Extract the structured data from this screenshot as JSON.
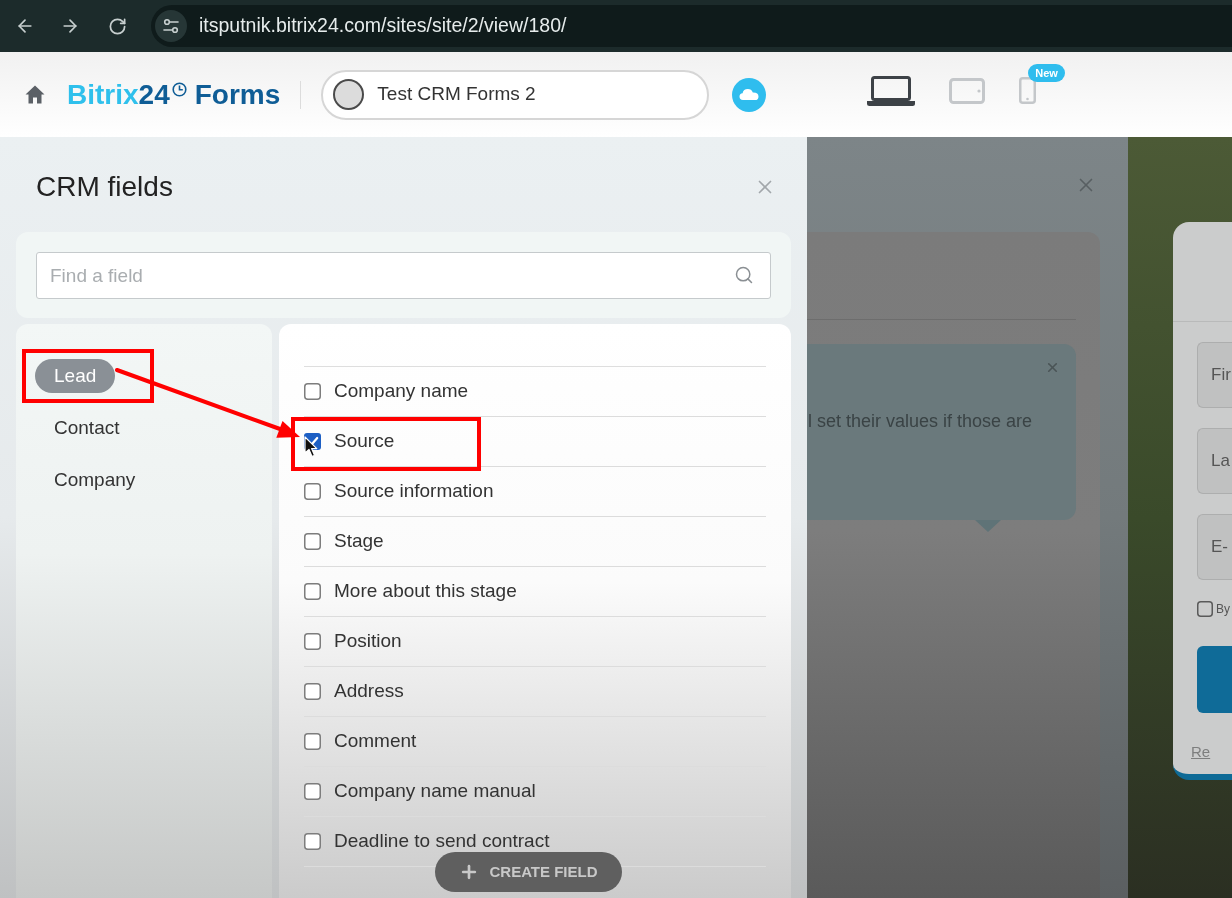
{
  "browser": {
    "url": "itsputnik.bitrix24.com/sites/site/2/view/180/"
  },
  "header": {
    "logo": {
      "brand": "Bitrix",
      "number": "24",
      "product": "Forms"
    },
    "site_selector": {
      "value": "Test CRM Forms 2"
    },
    "devices": [
      {
        "kind": "laptop",
        "selected": true
      },
      {
        "kind": "tablet",
        "selected": false
      },
      {
        "kind": "phone",
        "selected": false,
        "badge": "New"
      }
    ]
  },
  "crm_fields_panel": {
    "title": "CRM fields",
    "search": {
      "placeholder": "Find a field"
    },
    "entities": [
      {
        "label": "Lead",
        "selected": true
      },
      {
        "label": "Contact",
        "selected": false
      },
      {
        "label": "Company",
        "selected": false
      }
    ],
    "fields": [
      {
        "label": "Company name",
        "checked": false
      },
      {
        "label": "Source",
        "checked": true
      },
      {
        "label": "Source information",
        "checked": false
      },
      {
        "label": "Stage",
        "checked": false
      },
      {
        "label": "More about this stage",
        "checked": false
      },
      {
        "label": "Position",
        "checked": false
      },
      {
        "label": "Address",
        "checked": false
      },
      {
        "label": "Comment",
        "checked": false
      },
      {
        "label": "Company name manual",
        "checked": false
      },
      {
        "label": "Deadline to send contract",
        "checked": false
      }
    ],
    "create_button": "CREATE FIELD"
  },
  "background_page": {
    "hint_text": "l set their values if those are",
    "form": {
      "inputs": [
        "Fir",
        "La",
        "E-"
      ],
      "consent": {
        "label": "By",
        "checked": false
      },
      "link": "Re"
    }
  }
}
